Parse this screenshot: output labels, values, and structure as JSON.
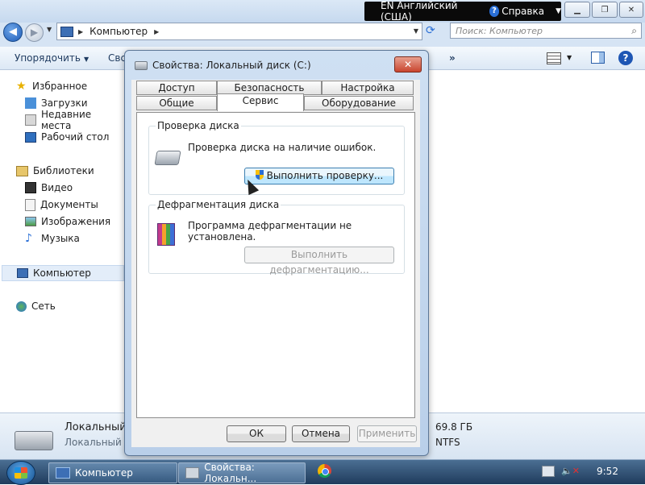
{
  "explorer": {
    "location": "Компьютер",
    "search_placeholder": "Поиск: Компьютер",
    "toolbar": {
      "organize": "Упорядочить",
      "clipped_item": "Свс",
      "more": "»"
    },
    "sidebar": {
      "favorites": "Избранное",
      "downloads": "Загрузки",
      "recent": "Недавние места",
      "desktop": "Рабочий стол",
      "libraries": "Библиотеки",
      "video": "Видео",
      "documents": "Документы",
      "images": "Изображения",
      "music": "Музыка",
      "computer": "Компьютер",
      "network": "Сеть"
    },
    "details": {
      "name": "Локальный д",
      "type": "Локальный д",
      "size": "69.8 ГБ",
      "fs": "NTFS"
    }
  },
  "langbar": {
    "lang": "EN Английский (США)",
    "help": "Справка"
  },
  "dialog": {
    "title": "Свойства: Локальный диск (C:)",
    "tabs_row1": [
      "Доступ",
      "Безопасность",
      "Настройка"
    ],
    "tabs_row2": [
      "Общие",
      "Сервис",
      "Оборудование"
    ],
    "active_tab": "Сервис",
    "check": {
      "legend": "Проверка диска",
      "text": "Проверка диска на наличие ошибок.",
      "button": "Выполнить проверку..."
    },
    "defrag": {
      "legend": "Дефрагментация диска",
      "text": "Программа дефрагментации не установлена.",
      "button": "Выполнить дефрагментацию..."
    },
    "buttons": {
      "ok": "ОК",
      "cancel": "Отмена",
      "apply": "Применить"
    }
  },
  "taskbar": {
    "task1": "Компьютер",
    "task2": "Свойства: Локальн...",
    "clock": "9:52"
  }
}
